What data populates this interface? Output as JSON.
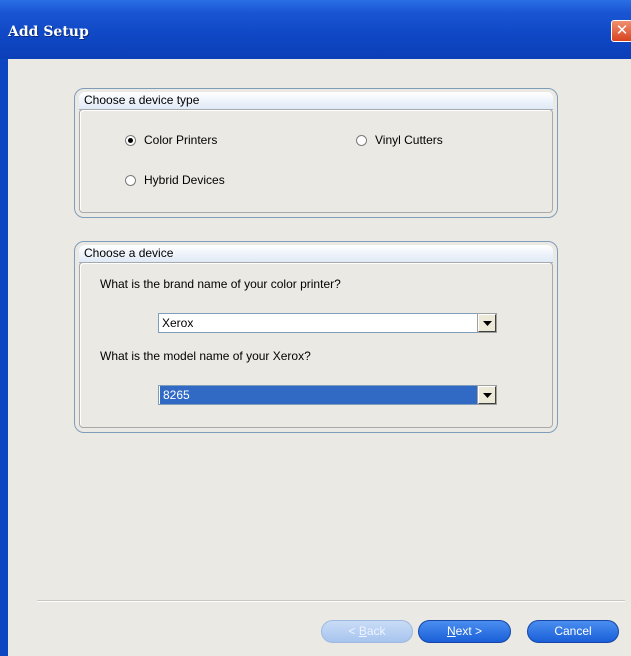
{
  "window": {
    "title": "Add Setup",
    "close_glyph": "✕"
  },
  "device_type_group": {
    "title": "Choose a device type",
    "options": [
      {
        "label": "Color Printers",
        "checked": true
      },
      {
        "label": "Vinyl Cutters",
        "checked": false
      },
      {
        "label": "Hybrid Devices",
        "checked": false
      }
    ]
  },
  "device_group": {
    "title": "Choose a device",
    "brand_question": "What is the brand name of your color printer?",
    "brand_value": "Xerox",
    "model_question": "What is the model name of your Xerox?",
    "model_value": "8265"
  },
  "buttons": {
    "back_prefix": "< ",
    "back_mnemonic": "B",
    "back_rest": "ack",
    "next_mnemonic": "N",
    "next_rest": "ext >",
    "cancel": "Cancel"
  },
  "colors": {
    "title_bar": "#0f47c4",
    "selection": "#316ac5",
    "close_button": "#d8431f"
  }
}
